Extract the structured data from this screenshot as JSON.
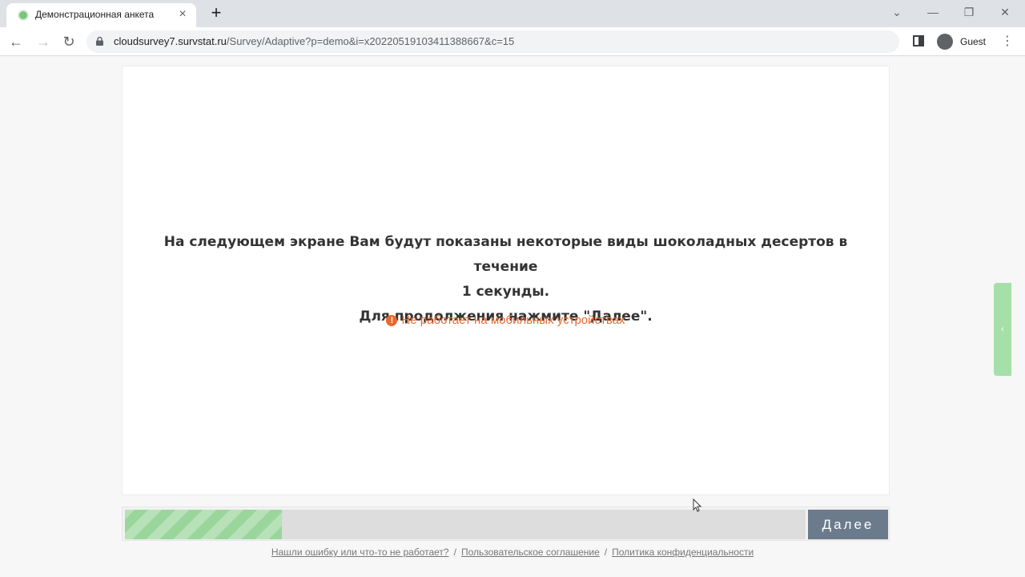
{
  "browser": {
    "tab_title": "Демонстрационная анкета",
    "url_host": "cloudsurvey7.survstat.ru",
    "url_path": "/Survey/Adaptive?p=demo&i=x20220519103411388667&c=15",
    "profile_label": "Guest"
  },
  "survey": {
    "question_line1": "На следующем экране Вам будут показаны некоторые виды шоколадных десертов в течение",
    "question_line2": "1 секунды.",
    "question_line3": "Для продолжения нажмите \"Далее\".",
    "warning": "Не работает на мобильных устройствах",
    "progress_fraction": 0.23,
    "next_label": "Далее"
  },
  "footer": {
    "link_report": "Нашли ошибку или что-то не работает?",
    "link_agreement": "Пользовательское соглашение",
    "link_privacy": "Политика конфиденциальности",
    "separator": "/"
  },
  "colors": {
    "accent_green": "#9ad69c",
    "warning_orange": "#e8692d",
    "button_gray": "#6b7b8c"
  }
}
